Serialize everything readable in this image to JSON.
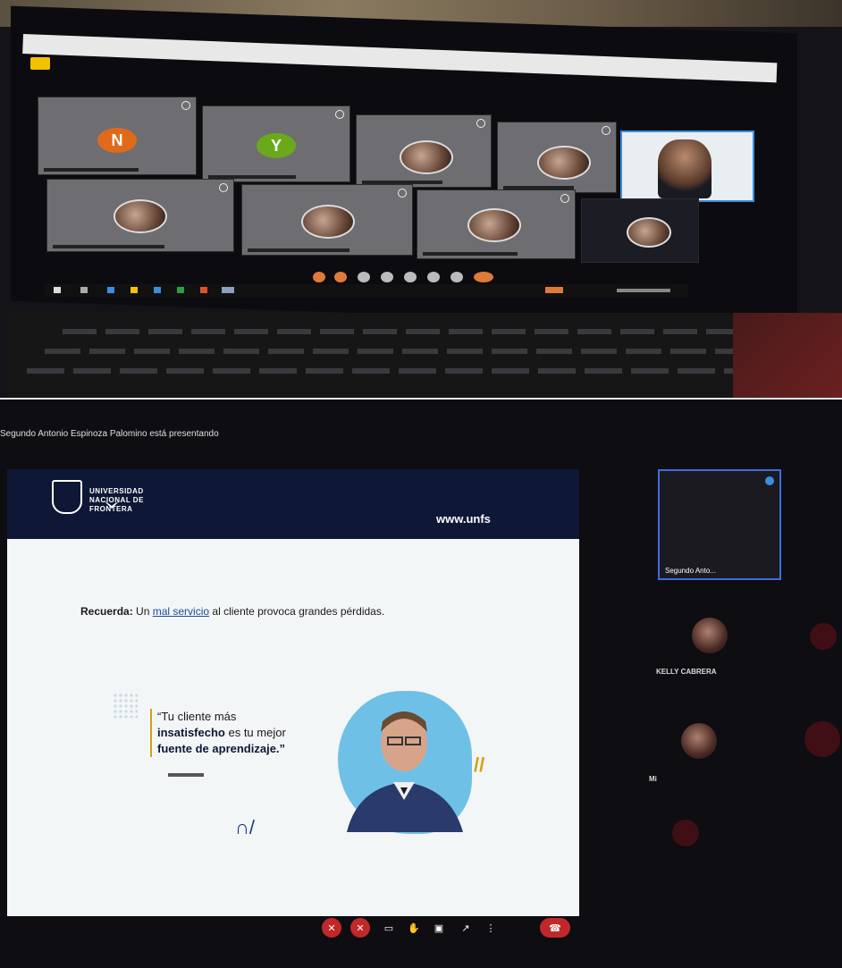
{
  "top_photo": {
    "browser_tab_color": "#f2c200",
    "gallery_tiles_row1": [
      {
        "avatar": "N",
        "avatar_color": "#e06a1a"
      },
      {
        "avatar": "Y",
        "avatar_color": "#6aaa1a"
      },
      {
        "avatar": "photo"
      },
      {
        "avatar": "photo"
      }
    ],
    "gallery_tiles_row2": [
      {
        "avatar": "photo"
      },
      {
        "avatar": "photo"
      },
      {
        "avatar": "photo"
      },
      {
        "avatar": "photo"
      }
    ],
    "active_speaker_border": "#3a8ee0"
  },
  "bottom_photo": {
    "presenting_text": "Segundo Antonio Espinoza Palomino está presentando",
    "slide": {
      "logo_text": "UNIVERSIDAD\nNACIONAL DE\nFRONTERA",
      "url": "www.unfs",
      "recuerda_label": "Recuerda:",
      "recuerda_pre": " Un ",
      "recuerda_link": "mal servicio",
      "recuerda_post": " al cliente provoca grandes pérdidas.",
      "quote_line1": "“Tu cliente más",
      "quote_line2_bold": "insatisfecho",
      "quote_line2_rest": " es tu mejor",
      "quote_line3": "fuente de aprendizaje.”",
      "hash_deco": "//",
      "curve_deco": "∩/",
      "accent_color": "#0e1735",
      "highlight_color": "#6fc0e6"
    },
    "side_participants": {
      "self_name": "Segundo Anto...",
      "participant_2": "KELLY CABRERA",
      "participant_3": "Mi"
    },
    "controls": {
      "mic": "mic-off-icon",
      "cam": "cam-off-icon",
      "captions": "cc-icon",
      "raise_hand": "hand-icon",
      "present": "present-icon",
      "more": "more-icon",
      "end_call": "end-call-icon",
      "end_call_color": "#c0282a"
    }
  }
}
